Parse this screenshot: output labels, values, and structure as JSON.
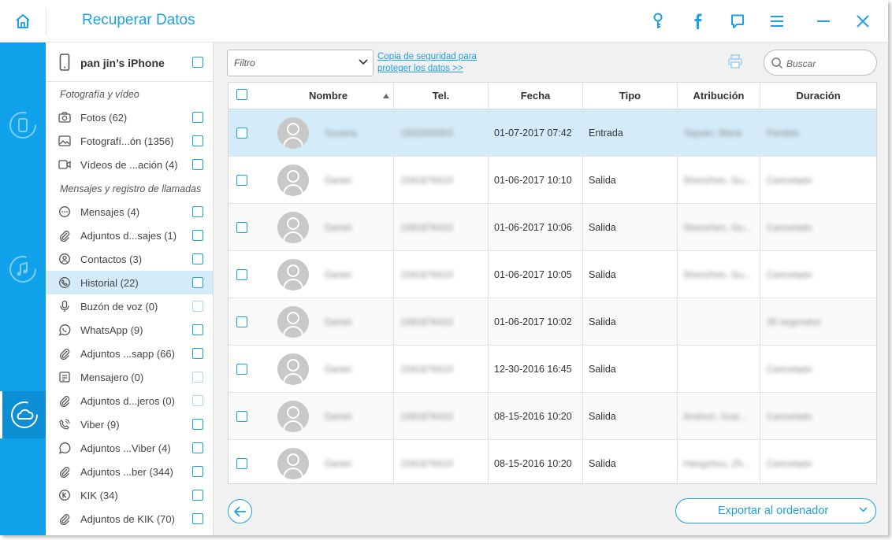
{
  "app": {
    "title": "Recuperar Datos"
  },
  "device": {
    "name": "pan jin’s iPhone"
  },
  "sidebar": {
    "section_photo": "Fotografía y vídeo",
    "section_msg": "Mensajes y registro de llamadas",
    "items": [
      {
        "label": "Fotos (62)",
        "icon": "camera-icon"
      },
      {
        "label": "Fotografí...ón (1356)",
        "icon": "image-icon"
      },
      {
        "label": "Vídeos de ...ación (4)",
        "icon": "video-icon"
      },
      {
        "label": "Mensajes (4)",
        "icon": "message-icon"
      },
      {
        "label": "Adjuntos d...sajes (1)",
        "icon": "paperclip-icon"
      },
      {
        "label": "Contactos (3)",
        "icon": "contacts-icon"
      },
      {
        "label": "Historial (22)",
        "icon": "phone-icon"
      },
      {
        "label": "Buzón de voz (0)",
        "icon": "microphone-icon"
      },
      {
        "label": "WhatsApp (9)",
        "icon": "whatsapp-icon"
      },
      {
        "label": "Adjuntos ...sapp (66)",
        "icon": "paperclip-icon"
      },
      {
        "label": "Mensajero (0)",
        "icon": "note-icon"
      },
      {
        "label": "Adjuntos d...jeros (0)",
        "icon": "paperclip-icon"
      },
      {
        "label": "Viber (9)",
        "icon": "viber-icon"
      },
      {
        "label": "Adjuntos ...Viber (4)",
        "icon": "paperclip-icon"
      },
      {
        "label": "Adjuntos ...ber (344)",
        "icon": "paperclip-icon"
      },
      {
        "label": "KIK (34)",
        "icon": "kik-icon"
      },
      {
        "label": "Adjuntos de KIK (70)",
        "icon": "paperclip-icon"
      }
    ]
  },
  "toolbar": {
    "filter_label": "Filtro",
    "backup_link_line1": "Copia de seguridad para",
    "backup_link_line2": "proteger los datos >>",
    "search_placeholder": "Buscar"
  },
  "table": {
    "columns": [
      "Nombre",
      "Tel.",
      "Fecha",
      "Tipo",
      "Atribución",
      "Duración"
    ],
    "rows": [
      {
        "name": "Susana",
        "tel": "1932000003",
        "date": "01-07-2017 07:42",
        "type": "Entrada",
        "attr": "Taipain, Wank",
        "dur": "Perdido"
      },
      {
        "name": "Daniel",
        "tel": "1581876410",
        "date": "01-06-2017 10:10",
        "type": "Salida",
        "attr": "Shenzhen, Gu...",
        "dur": "Cancelado"
      },
      {
        "name": "Daniel",
        "tel": "1581876410",
        "date": "01-06-2017 10:06",
        "type": "Salida",
        "attr": "Shenzhen, Gu...",
        "dur": "Cancelado"
      },
      {
        "name": "Daniel",
        "tel": "1581876410",
        "date": "01-06-2017 10:05",
        "type": "Salida",
        "attr": "Shenzhen, Gu...",
        "dur": "Cancelado"
      },
      {
        "name": "Daniel",
        "tel": "1581876410",
        "date": "01-06-2017 10:02",
        "type": "Salida",
        "attr": "",
        "dur": "30 segundos"
      },
      {
        "name": "Daniel",
        "tel": "1581876410",
        "date": "12-30-2016 16:45",
        "type": "Salida",
        "attr": "",
        "dur": "Cancelado"
      },
      {
        "name": "Daniel",
        "tel": "1581876410",
        "date": "08-15-2016 10:20",
        "type": "Salida",
        "attr": "Anshun, Guiz...",
        "dur": "Cancelado"
      },
      {
        "name": "Daniel",
        "tel": "1581876410",
        "date": "08-15-2016 10:20",
        "type": "Salida",
        "attr": "Hangzhou, Zh...",
        "dur": "Cancelado"
      }
    ]
  },
  "footer": {
    "export_label": "Exportar al ordenador"
  },
  "colors": {
    "accent": "#1ea0e6",
    "rail": "#0fa2ea",
    "selected_row": "#d4ecf9"
  }
}
